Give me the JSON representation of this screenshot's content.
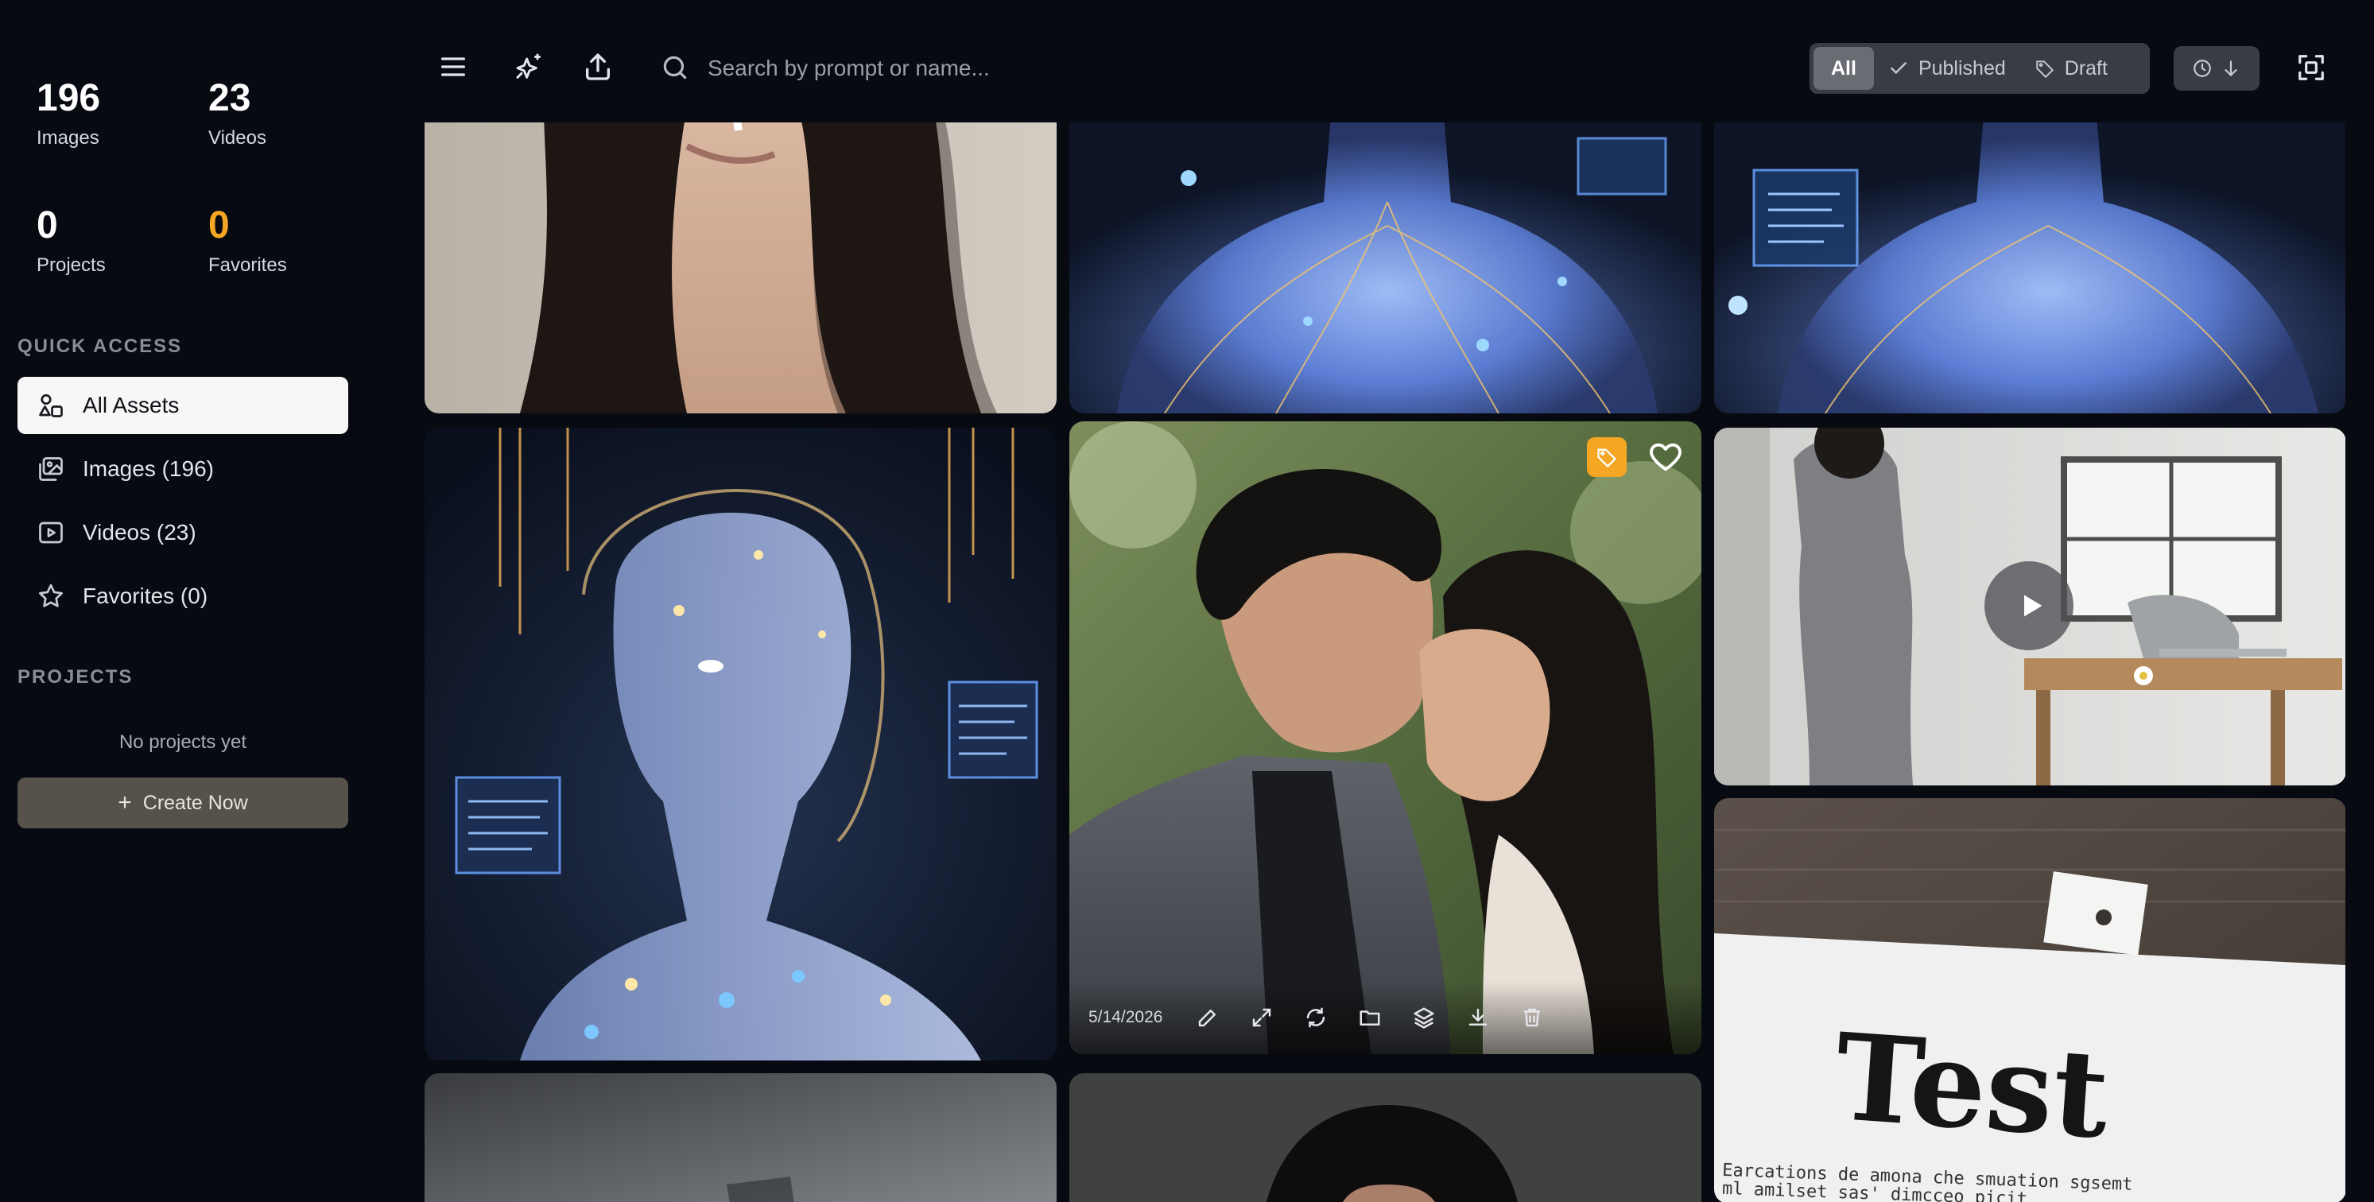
{
  "stats": [
    {
      "value": "196",
      "label": "Images"
    },
    {
      "value": "23",
      "label": "Videos"
    },
    {
      "value": "0",
      "label": "Projects"
    },
    {
      "value": "0",
      "label": "Favorites"
    }
  ],
  "sidebar": {
    "quick_access_title": "QUICK ACCESS",
    "items": [
      {
        "label": "All Assets",
        "icon": "shapes-icon"
      },
      {
        "label": "Images (196)",
        "icon": "images-icon"
      },
      {
        "label": "Videos (23)",
        "icon": "video-icon"
      },
      {
        "label": "Favorites (0)",
        "icon": "star-icon"
      }
    ],
    "projects_title": "PROJECTS",
    "projects_empty": "No projects yet",
    "create_button": "Create Now"
  },
  "toolbar": {
    "search_placeholder": "Search by prompt or name...",
    "filters": [
      {
        "label": "All",
        "active": true
      },
      {
        "label": "Published",
        "icon": "check-icon"
      },
      {
        "label": "Draft",
        "icon": "tag-icon"
      }
    ]
  },
  "gallery": {
    "featured_date": "5/14/2026",
    "test_text": "Test",
    "test_subtext_1": "Earcations de amona che smuation sgsemt",
    "test_subtext_2": "ml amilset sas' dimcceo picit"
  },
  "colors": {
    "background": "#080a12",
    "accent_orange": "#f5a623",
    "active_nav_bg": "#f7f7f8",
    "create_button_bg": "#56524a"
  }
}
